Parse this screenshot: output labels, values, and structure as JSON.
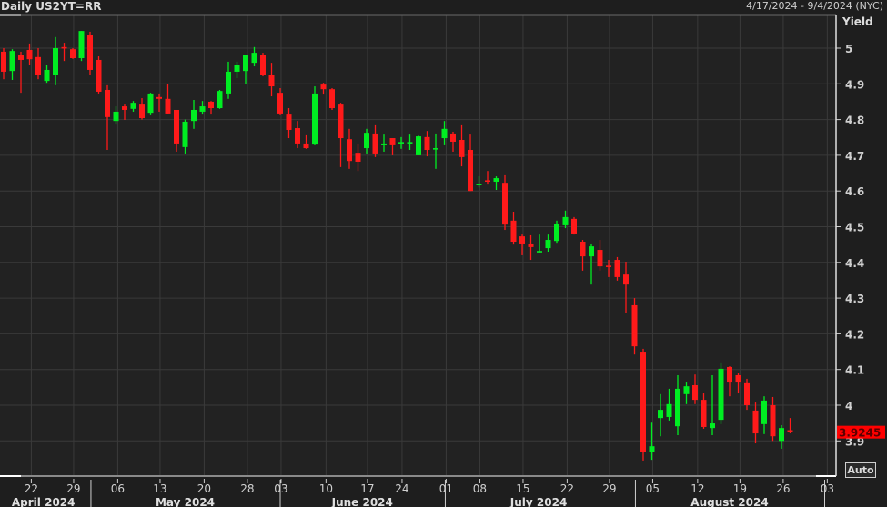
{
  "header": {
    "title": "Daily US2YT=RR",
    "date_range": "4/17/2024 - 9/4/2024 (NYC)"
  },
  "controls": {
    "auto_label": "Auto"
  },
  "colors": {
    "up": "#00ee22",
    "down": "#ff1a1a",
    "background": "#222222",
    "grid": "#3a3a3a",
    "last_price_bg": "#ff0000"
  },
  "chart_data": {
    "type": "candlestick",
    "title": "Daily US2YT=RR",
    "ylabel": "Yield",
    "ylim": [
      3.82,
      5.09
    ],
    "yticks": [
      "5",
      "4.9",
      "4.8",
      "4.7",
      "4.6",
      "4.5",
      "4.4",
      "4.3",
      "4.2",
      "4.1",
      "4",
      "3.9"
    ],
    "ytick_values": [
      5,
      4.9,
      4.8,
      4.7,
      4.6,
      4.5,
      4.4,
      4.3,
      4.2,
      4.1,
      4.0,
      3.9
    ],
    "last_price": "3.9245",
    "grid": true,
    "xticks": [
      {
        "label": "22",
        "index": 3.2
      },
      {
        "label": "29",
        "index": 8.1
      },
      {
        "label": "06",
        "index": 13.2
      },
      {
        "label": "13",
        "index": 18.1
      },
      {
        "label": "20",
        "index": 23.2
      },
      {
        "label": "28",
        "index": 28.2
      },
      {
        "label": "03",
        "index": 32.1
      },
      {
        "label": "10",
        "index": 37.3
      },
      {
        "label": "17",
        "index": 42.1
      },
      {
        "label": "24",
        "index": 46.1
      },
      {
        "label": "01",
        "index": 51.2
      },
      {
        "label": "08",
        "index": 55.1
      },
      {
        "label": "15",
        "index": 60.1
      },
      {
        "label": "22",
        "index": 65.2
      },
      {
        "label": "29",
        "index": 70.1
      },
      {
        "label": "05",
        "index": 75.1
      },
      {
        "label": "12",
        "index": 80.3
      },
      {
        "label": "19",
        "index": 85.2
      },
      {
        "label": "26",
        "index": 90.2
      },
      {
        "label": "03",
        "index": 95.3
      }
    ],
    "months": [
      {
        "label": "April 2024",
        "center": 4.6,
        "end": 10.1
      },
      {
        "label": "May 2024",
        "center": 21.0,
        "end": 32.0
      },
      {
        "label": "June 2024",
        "center": 41.5,
        "end": 51.1
      },
      {
        "label": "July 2024",
        "center": 61.9,
        "end": 73.1
      },
      {
        "label": "August 2024",
        "center": 84.0,
        "end": 95.0
      }
    ],
    "ohlc": [
      [
        4.99,
        5.0,
        4.913,
        4.934
      ],
      [
        4.936,
        4.997,
        4.911,
        4.992
      ],
      [
        4.98,
        4.99,
        4.875,
        4.967
      ],
      [
        4.995,
        5.013,
        4.952,
        4.969
      ],
      [
        4.975,
        5.0,
        4.913,
        4.924
      ],
      [
        4.908,
        4.954,
        4.903,
        4.939
      ],
      [
        4.926,
        5.031,
        4.896,
        5.0
      ],
      [
        5.003,
        5.015,
        4.964,
        4.999
      ],
      [
        4.997,
        5.0,
        4.97,
        4.972
      ],
      [
        4.972,
        5.048,
        4.964,
        5.048
      ],
      [
        5.036,
        5.046,
        4.924,
        4.939
      ],
      [
        4.967,
        4.977,
        4.873,
        4.878
      ],
      [
        4.883,
        4.896,
        4.715,
        4.807
      ],
      [
        4.796,
        4.837,
        4.786,
        4.822
      ],
      [
        4.837,
        4.842,
        4.799,
        4.827
      ],
      [
        4.83,
        4.852,
        4.822,
        4.847
      ],
      [
        4.842,
        4.86,
        4.8,
        4.804
      ],
      [
        4.819,
        4.875,
        4.812,
        4.873
      ],
      [
        4.863,
        4.873,
        4.822,
        4.858
      ],
      [
        4.858,
        4.9,
        4.817,
        4.817
      ],
      [
        4.827,
        4.827,
        4.71,
        4.733
      ],
      [
        4.723,
        4.8,
        4.705,
        4.794
      ],
      [
        4.796,
        4.855,
        4.774,
        4.827
      ],
      [
        4.822,
        4.852,
        4.814,
        4.837
      ],
      [
        4.85,
        4.852,
        4.814,
        4.832
      ],
      [
        4.832,
        4.883,
        4.83,
        4.88
      ],
      [
        4.873,
        4.962,
        4.858,
        4.934
      ],
      [
        4.934,
        4.962,
        4.916,
        4.954
      ],
      [
        4.936,
        4.982,
        4.9,
        4.982
      ],
      [
        4.959,
        5.003,
        4.949,
        4.987
      ],
      [
        4.982,
        4.987,
        4.921,
        4.926
      ],
      [
        4.926,
        4.959,
        4.865,
        4.893
      ],
      [
        4.875,
        4.888,
        4.812,
        4.817
      ],
      [
        4.814,
        4.832,
        4.748,
        4.771
      ],
      [
        4.776,
        4.796,
        4.72,
        4.733
      ],
      [
        4.733,
        4.756,
        4.718,
        4.72
      ],
      [
        4.73,
        4.893,
        4.728,
        4.873
      ],
      [
        4.898,
        4.903,
        4.87,
        4.885
      ],
      [
        4.885,
        4.888,
        4.827,
        4.832
      ],
      [
        4.842,
        4.847,
        4.667,
        4.748
      ],
      [
        4.745,
        4.774,
        4.662,
        4.684
      ],
      [
        4.707,
        4.733,
        4.656,
        4.682
      ],
      [
        4.72,
        4.774,
        4.705,
        4.763
      ],
      [
        4.761,
        4.784,
        4.695,
        4.705
      ],
      [
        4.728,
        4.758,
        4.71,
        4.733
      ],
      [
        4.748,
        4.748,
        4.7,
        4.728
      ],
      [
        4.733,
        4.751,
        4.718,
        4.737
      ],
      [
        4.733,
        4.758,
        4.715,
        4.737
      ],
      [
        4.7,
        4.755,
        4.7,
        4.753
      ],
      [
        4.751,
        4.768,
        4.697,
        4.715
      ],
      [
        4.716,
        4.761,
        4.662,
        4.72
      ],
      [
        4.748,
        4.796,
        4.728,
        4.774
      ],
      [
        4.761,
        4.766,
        4.71,
        4.738
      ],
      [
        4.743,
        4.784,
        4.669,
        4.695
      ],
      [
        4.715,
        4.758,
        4.6,
        4.6
      ],
      [
        4.616,
        4.641,
        4.61,
        4.62
      ],
      [
        4.63,
        4.656,
        4.618,
        4.626
      ],
      [
        4.626,
        4.641,
        4.603,
        4.636
      ],
      [
        4.623,
        4.644,
        4.491,
        4.506
      ],
      [
        4.517,
        4.542,
        4.45,
        4.458
      ],
      [
        4.473,
        4.478,
        4.42,
        4.453
      ],
      [
        4.453,
        4.476,
        4.407,
        4.443
      ],
      [
        4.428,
        4.478,
        4.428,
        4.432
      ],
      [
        4.44,
        4.478,
        4.43,
        4.463
      ],
      [
        4.46,
        4.517,
        4.455,
        4.509
      ],
      [
        4.504,
        4.545,
        4.496,
        4.527
      ],
      [
        4.522,
        4.527,
        4.478,
        4.481
      ],
      [
        4.458,
        4.463,
        4.377,
        4.417
      ],
      [
        4.417,
        4.453,
        4.338,
        4.445
      ],
      [
        4.435,
        4.463,
        4.377,
        4.389
      ],
      [
        4.391,
        4.407,
        4.359,
        4.389
      ],
      [
        4.407,
        4.415,
        4.349,
        4.359
      ],
      [
        4.366,
        4.402,
        4.257,
        4.338
      ],
      [
        4.28,
        4.3,
        4.142,
        4.165
      ],
      [
        4.15,
        4.158,
        3.845,
        3.87
      ],
      [
        3.868,
        3.951,
        3.847,
        3.885
      ],
      [
        3.964,
        4.031,
        3.913,
        3.987
      ],
      [
        3.967,
        4.046,
        3.957,
        4.003
      ],
      [
        3.941,
        4.084,
        3.916,
        4.046
      ],
      [
        4.031,
        4.066,
        4.003,
        4.053
      ],
      [
        4.056,
        4.086,
        4.003,
        4.015
      ],
      [
        4.015,
        4.033,
        3.934,
        3.939
      ],
      [
        3.936,
        4.084,
        3.916,
        3.949
      ],
      [
        3.959,
        4.12,
        3.947,
        4.102
      ],
      [
        4.107,
        4.109,
        4.025,
        4.066
      ],
      [
        4.084,
        4.089,
        4.033,
        4.066
      ],
      [
        4.064,
        4.074,
        3.987,
        4.0
      ],
      [
        3.985,
        4.01,
        3.893,
        3.921
      ],
      [
        3.947,
        4.025,
        3.919,
        4.013
      ],
      [
        4.0,
        4.023,
        3.9,
        3.913
      ],
      [
        3.9,
        3.944,
        3.878,
        3.936
      ],
      [
        3.93,
        3.964,
        3.921,
        3.9245
      ]
    ]
  }
}
